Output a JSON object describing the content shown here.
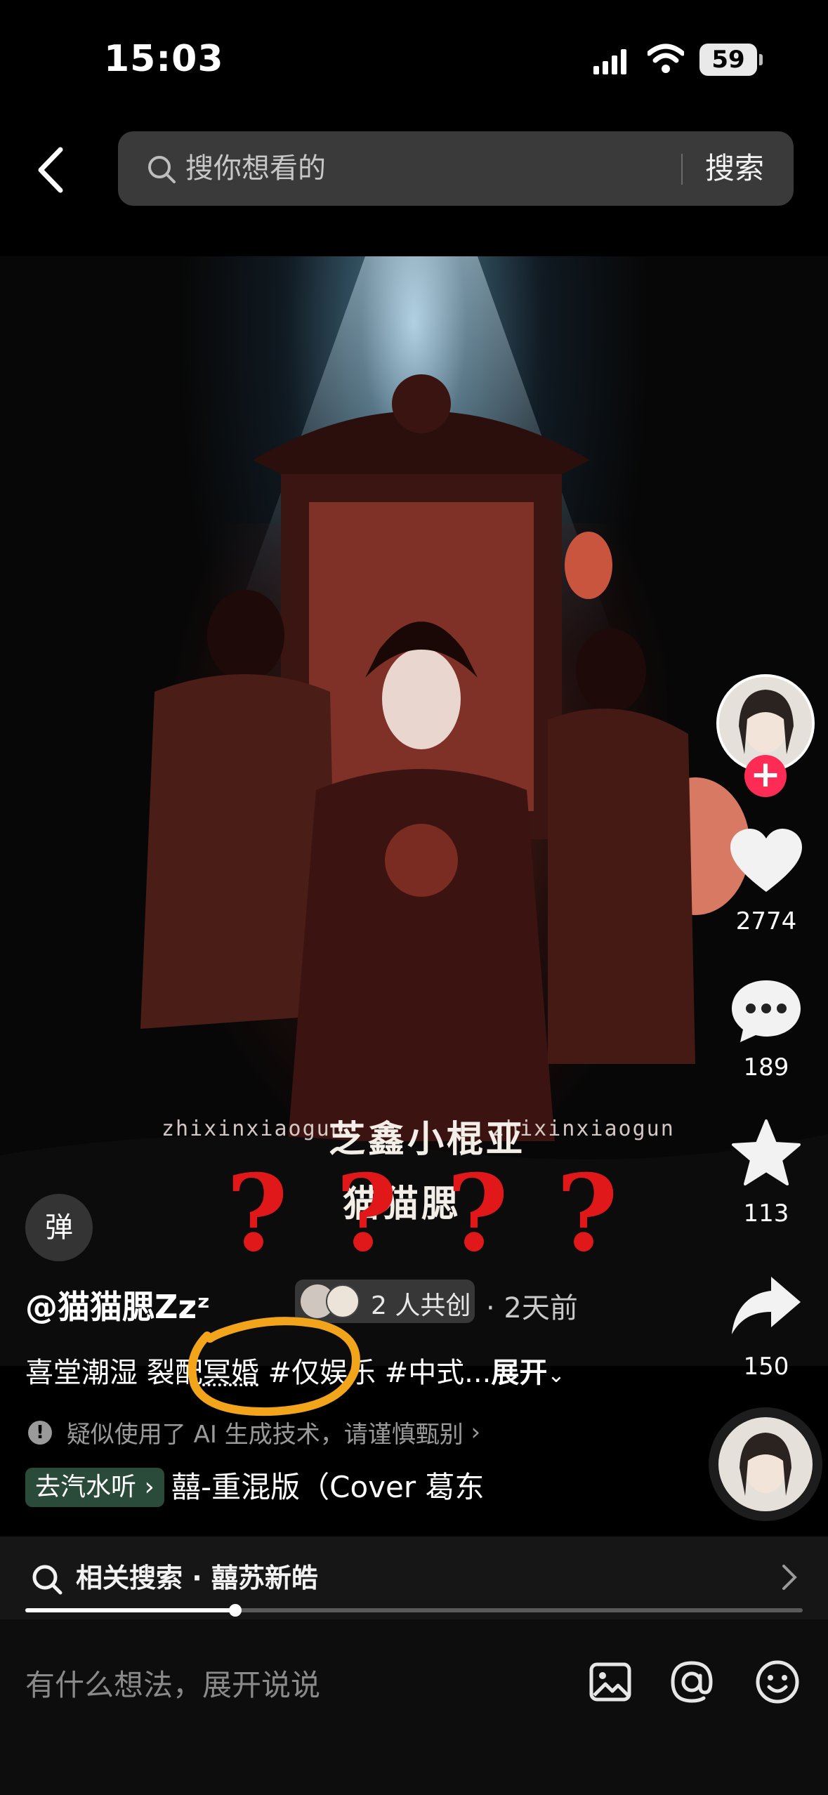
{
  "status_bar": {
    "time": "15:03",
    "battery": "59"
  },
  "header": {
    "search_placeholder": "搜你想看的",
    "search_button": "搜索"
  },
  "video": {
    "watermark_left": "zhixinxiaogun",
    "watermark_right": "zhixinxiaogun",
    "watermark_center": "芝鑫小棍亚",
    "watermark_sub": "猫猫腮",
    "question_marks": [
      "?",
      "?",
      "?",
      "?"
    ]
  },
  "danmaku_label": "弹",
  "rail": {
    "like_count": "2774",
    "comment_count": "189",
    "favorite_count": "113",
    "share_count": "150"
  },
  "post": {
    "author": "@猫猫腮Zzᶻ",
    "coauthor_label": "2 人共创",
    "time": "· 2天前",
    "description_plain": "喜堂潮湿 裂配",
    "tag_1": "冥婚",
    "tag_2": "#仅娱乐",
    "tag_3": "#中式...",
    "expand": "展开",
    "ai_notice": "疑似使用了 AI 生成技术，请谨慎甄别",
    "music_chip": "去汽水听",
    "music_title": "囍-重混版（Cover 葛东"
  },
  "related_search": {
    "label": "相关搜索 · 囍苏新皓"
  },
  "progress": {
    "fraction": 0.27
  },
  "comment_bar": {
    "placeholder": "有什么想法，展开说说"
  },
  "colors": {
    "accent_red": "#fe2c55",
    "annotation_orange": "#f2a51a",
    "question_red": "#e0181a"
  },
  "icons": [
    "back-icon",
    "search-icon",
    "heart-icon",
    "comment-icon",
    "star-icon",
    "share-icon",
    "image-icon",
    "at-icon",
    "emoji-icon"
  ]
}
